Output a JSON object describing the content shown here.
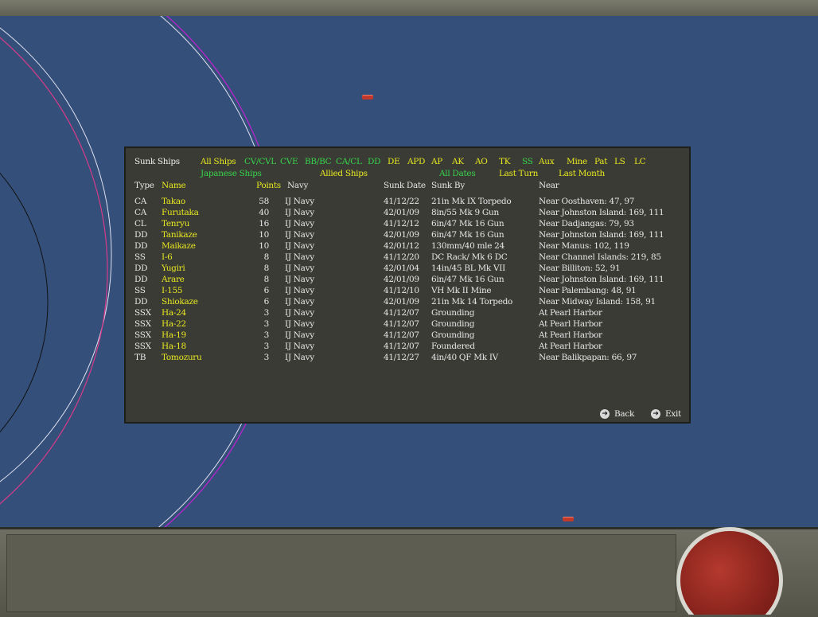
{
  "panel": {
    "title": "Sunk Ships",
    "filters_row1": [
      {
        "label": "All Ships",
        "color": "yellow"
      },
      {
        "label": "CV/CVL",
        "color": "green"
      },
      {
        "label": "CVE",
        "color": "green"
      },
      {
        "label": "BB/BC",
        "color": "green"
      },
      {
        "label": "CA/CL",
        "color": "green"
      },
      {
        "label": "DD",
        "color": "green"
      },
      {
        "label": "DE",
        "color": "yellow"
      },
      {
        "label": "APD",
        "color": "yellow"
      },
      {
        "label": "AP",
        "color": "yellow"
      },
      {
        "label": "AK",
        "color": "yellow"
      },
      {
        "label": "AO",
        "color": "yellow"
      },
      {
        "label": "TK",
        "color": "yellow"
      },
      {
        "label": "SS",
        "color": "green"
      },
      {
        "label": "Aux",
        "color": "yellow"
      },
      {
        "label": "Mine",
        "color": "yellow"
      },
      {
        "label": "Pat",
        "color": "yellow"
      },
      {
        "label": "LS",
        "color": "yellow"
      },
      {
        "label": "LC",
        "color": "yellow"
      }
    ],
    "filters_row2": [
      {
        "label": "Japanese Ships",
        "color": "green"
      },
      {
        "label": "Allied Ships",
        "color": "yellow"
      },
      {
        "label": "All Dates",
        "color": "green"
      },
      {
        "label": "Last Turn",
        "color": "yellow"
      },
      {
        "label": "Last Month",
        "color": "yellow"
      }
    ],
    "columns": {
      "type": "Type",
      "name": "Name",
      "points": "Points",
      "navy": "Navy",
      "sunk_date": "Sunk Date",
      "sunk_by": "Sunk By",
      "near": "Near"
    },
    "rows": [
      {
        "type": "CA",
        "name": "Takao",
        "points": "58",
        "navy": "IJ Navy",
        "date": "41/12/22",
        "by": "21in Mk IX Torpedo",
        "near": "Near Oosthaven: 47, 97"
      },
      {
        "type": "CA",
        "name": "Furutaka",
        "points": "40",
        "navy": "IJ Navy",
        "date": "42/01/09",
        "by": "8in/55 Mk 9 Gun",
        "near": "Near Johnston Island: 169, 111"
      },
      {
        "type": "CL",
        "name": "Tenryu",
        "points": "16",
        "navy": "IJ Navy",
        "date": "41/12/12",
        "by": "6in/47 Mk 16 Gun",
        "near": "Near Dadjangas: 79, 93"
      },
      {
        "type": "DD",
        "name": "Tanikaze",
        "points": "10",
        "navy": "IJ Navy",
        "date": "42/01/09",
        "by": "6in/47 Mk 16 Gun",
        "near": "Near Johnston Island: 169, 111"
      },
      {
        "type": "DD",
        "name": "Maikaze",
        "points": "10",
        "navy": "IJ Navy",
        "date": "42/01/12",
        "by": "130mm/40 mle 24",
        "near": "Near Manus: 102, 119"
      },
      {
        "type": "SS",
        "name": "I-6",
        "points": "8",
        "navy": "IJ Navy",
        "date": "41/12/20",
        "by": "DC Rack/ Mk 6 DC",
        "near": "Near Channel Islands: 219, 85"
      },
      {
        "type": "DD",
        "name": "Yugiri",
        "points": "8",
        "navy": "IJ Navy",
        "date": "42/01/04",
        "by": "14in/45 BL Mk VII",
        "near": "Near Billiton: 52, 91"
      },
      {
        "type": "DD",
        "name": "Arare",
        "points": "8",
        "navy": "IJ Navy",
        "date": "42/01/09",
        "by": "6in/47 Mk 16 Gun",
        "near": "Near Johnston Island: 169, 111"
      },
      {
        "type": "SS",
        "name": "I-155",
        "points": "6",
        "navy": "IJ Navy",
        "date": "41/12/10",
        "by": "VH Mk II Mine",
        "near": "Near Palembang: 48, 91"
      },
      {
        "type": "DD",
        "name": "Shiokaze",
        "points": "6",
        "navy": "IJ Navy",
        "date": "42/01/09",
        "by": "21in Mk 14 Torpedo",
        "near": "Near Midway Island: 158, 91"
      },
      {
        "type": "SSX",
        "name": "Ha-24",
        "points": "3",
        "navy": "IJ Navy",
        "date": "41/12/07",
        "by": "Grounding",
        "near": "At Pearl Harbor"
      },
      {
        "type": "SSX",
        "name": "Ha-22",
        "points": "3",
        "navy": "IJ Navy",
        "date": "41/12/07",
        "by": "Grounding",
        "near": "At Pearl Harbor"
      },
      {
        "type": "SSX",
        "name": "Ha-19",
        "points": "3",
        "navy": "IJ Navy",
        "date": "41/12/07",
        "by": "Grounding",
        "near": "At Pearl Harbor"
      },
      {
        "type": "SSX",
        "name": "Ha-18",
        "points": "3",
        "navy": "IJ Navy",
        "date": "41/12/07",
        "by": "Foundered",
        "near": "At Pearl Harbor"
      },
      {
        "type": "TB",
        "name": "Tomozuru",
        "points": "3",
        "navy": "IJ Navy",
        "date": "41/12/27",
        "by": "4in/40 QF Mk IV",
        "near": "Near Balikpapan: 66, 97"
      }
    ],
    "back_label": "Back",
    "exit_label": "Exit"
  },
  "colors": {
    "yellow": "#e8e820",
    "green": "#37d34a",
    "panel": "#3a3b35",
    "sea": "#34507a"
  },
  "icons": {
    "back": "arrow-right-icon",
    "exit": "arrow-right-icon",
    "seal": "red-seal-emblem"
  }
}
